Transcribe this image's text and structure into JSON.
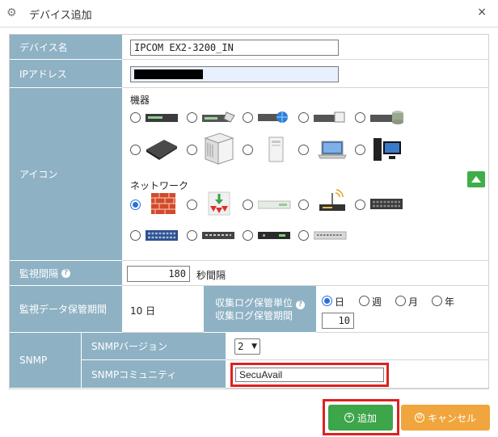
{
  "dialog": {
    "title": "デバイス追加",
    "close_glyph": "×"
  },
  "fields": {
    "device_name_label": "デバイス名",
    "device_name_value": "IPCOM EX2-3200_IN",
    "ip_label": "IPアドレス",
    "icon_label": "アイコン",
    "equipment_title": "機器",
    "network_title": "ネットワーク",
    "interval_label": "監視間隔",
    "interval_value": "180",
    "interval_unit": "秒間隔",
    "retention_label": "監視データ保管期間",
    "retention_value": "10 日",
    "log_unit_label": "収集ログ保管単位",
    "log_period_label": "収集ログ保管期間",
    "log_period_value": "10",
    "snmp_label": "SNMP",
    "snmp_version_label": "SNMPバージョン",
    "snmp_version_value": "2",
    "snmp_community_label": "SNMPコミュニティ",
    "snmp_community_value": "SecuAvail"
  },
  "log_units": [
    {
      "label": "日",
      "checked": true
    },
    {
      "label": "週",
      "checked": false
    },
    {
      "label": "月",
      "checked": false
    },
    {
      "label": "年",
      "checked": false
    }
  ],
  "icons": {
    "equipment": [
      "rack-server-icon",
      "rack-server-pen-icon",
      "rack-server-globe-icon",
      "rack-server-box-icon",
      "rack-server-db-icon",
      "appliance-icon",
      "tower-server-icon",
      "slim-tower-icon",
      "laptop-icon",
      "desktop-pc-icon"
    ],
    "network": [
      "firewall-icon",
      "router-arrows-icon",
      "flat-switch-icon",
      "wifi-router-icon",
      "patch-switch-icon",
      "blue-switch-icon",
      "hub-icon",
      "dark-switch-icon",
      "gray-switch-icon"
    ],
    "selected_network_index": 0
  },
  "buttons": {
    "add_label": "追加",
    "cancel_label": "キャンセル"
  },
  "colors": {
    "label_bg": "#8eb1c4",
    "add_btn": "#3ea64a",
    "cancel_btn": "#f0a63d",
    "highlight": "#e02020"
  }
}
